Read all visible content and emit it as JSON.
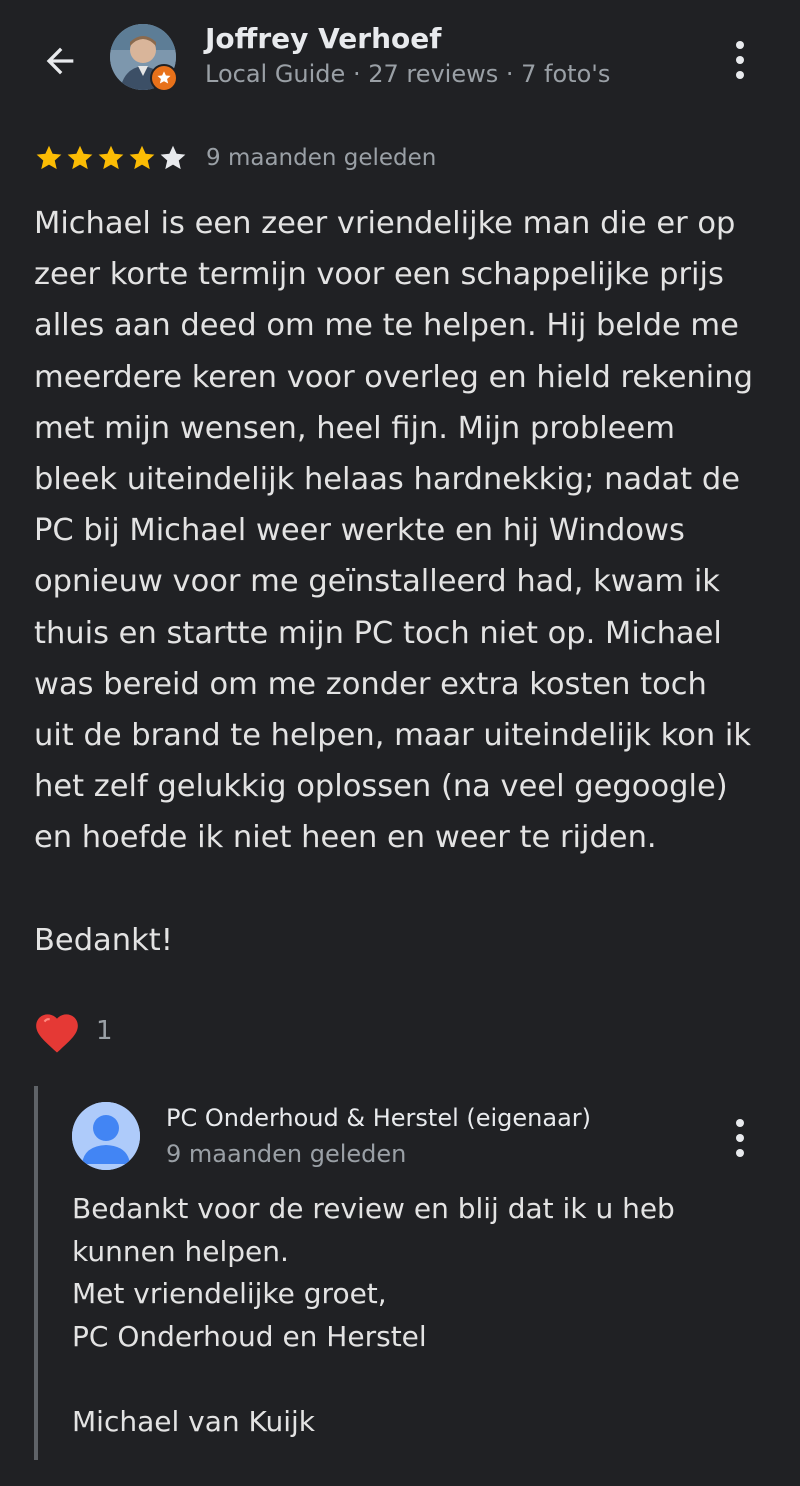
{
  "reviewer": {
    "name": "Joffrey Verhoef",
    "meta": "Local Guide · 27 reviews · 7 foto's"
  },
  "rating": {
    "stars": 4,
    "max": 5,
    "date": "9 maanden geleden",
    "star_color": "#fbbc04"
  },
  "review": {
    "body": "Michael is een zeer vriendelijke man die er op\nzeer korte termijn voor een schappelijke prijs\nalles aan deed om me te helpen. Hij belde me\nmeerdere keren voor overleg en hield rekening\nmet mijn wensen, heel fijn. Mijn probleem\nbleek uiteindelijk helaas hardnekkig; nadat de\nPC bij Michael weer werkte en hij Windows\nopnieuw voor me geïnstalleerd had, kwam ik\nthuis en startte mijn PC toch niet op. Michael\nwas bereid om me zonder extra kosten toch\nuit de brand te helpen, maar uiteindelijk kon ik\nhet zelf gelukkig oplossen (na veel gegoogle)\nen hoefde ik niet heen en weer te rijden.",
    "closing": "Bedankt!"
  },
  "reaction": {
    "icon": "heart-icon",
    "count": "1"
  },
  "owner_reply": {
    "name": "PC Onderhoud & Herstel (eigenaar)",
    "date": "9 maanden geleden",
    "body": "Bedankt voor de review en blij dat ik u heb\nkunnen helpen.\nMet vriendelijke groet,\nPC Onderhoud en Herstel",
    "signature": "Michael van Kuijk"
  },
  "colors": {
    "background": "#202124",
    "text": "#e3e3e3",
    "muted": "#9aa0a6",
    "badge": "#e8711a",
    "heart": "#e53935"
  }
}
